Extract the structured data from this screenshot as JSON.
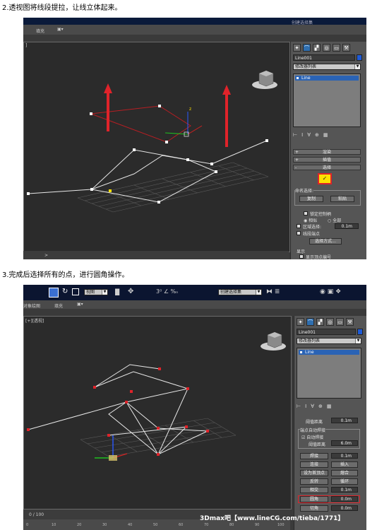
{
  "captions": {
    "step2": "2.透视图将线段提拉，让线立体起来。",
    "step3": "3.完成后选择所有的点，进行圆角操作。"
  },
  "shot1": {
    "toolbar_left": "填充",
    "toolbar_right": "创建选择集",
    "command_panel": {
      "object_name": "Line001",
      "modifier_list": "修改器列表",
      "stack_item": "Line",
      "rollouts": [
        {
          "sign": "+",
          "label": "渲染"
        },
        {
          "sign": "+",
          "label": "插值"
        },
        {
          "sign": "-",
          "label": "选择"
        }
      ],
      "named_selections_title": "命名选择:",
      "copy_button": "复制",
      "paste_button": "粘贴",
      "lock_handles": "锁定控制柄",
      "similar": "相似",
      "all": "全部",
      "area_selection": "区域选择:",
      "area_value": "0.1m",
      "segment_end": "线段端点",
      "select_by": "选择方式...",
      "display": "显示",
      "show_vertex_numbers": "显示顶点编号"
    },
    "colors": {
      "accent": "#1e5bd8",
      "highlight": "#ffe100",
      "red_handle": "#e0232a"
    }
  },
  "shot2": {
    "view_dropdown": "视图",
    "selection_set": "创建选择集",
    "toolbar_left": "对象绘图",
    "toolbar_mid": "填充",
    "viewport_label": "[+][透视]",
    "command_panel": {
      "object_name": "Line001",
      "modifier_list": "修改器列表",
      "stack_item": "Line",
      "threshold_label": "阈值距离",
      "threshold_value": "0.1m",
      "endpoint_weld": "端点自动焊接",
      "auto_weld": "自动焊接",
      "threshold2_label": "阈值距离",
      "threshold2_value": "6.0m",
      "weld": "焊接",
      "weld_value": "0.1m",
      "connect": "连接",
      "insert": "插入",
      "make_first": "设为首顶点",
      "fuse": "熔合",
      "reverse": "反转",
      "cycle": "循环",
      "crossinsert": "相交",
      "crossinsert_value": "0.1m",
      "fillet": "圆角",
      "fillet_value": "0.0m",
      "chamfer": "切角",
      "chamfer_value": "0.0m"
    },
    "timeline": {
      "frame": "0 / 100",
      "ticks": [
        "0",
        "10",
        "20",
        "30",
        "40",
        "50",
        "60",
        "70",
        "80",
        "90",
        "100"
      ]
    },
    "watermark": "3Dmax吧【www.lineCG.com/tieba/1771】"
  }
}
